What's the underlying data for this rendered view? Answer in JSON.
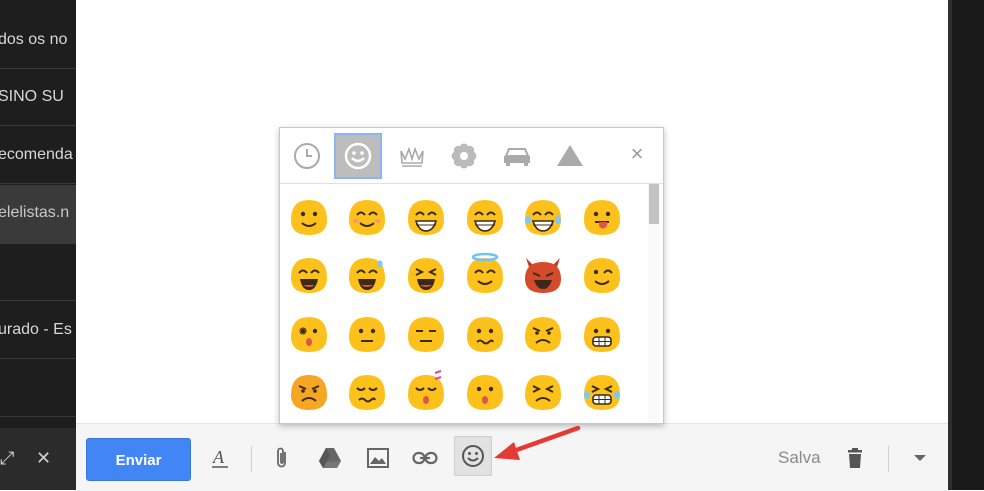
{
  "inbox": {
    "rows": [
      {
        "text": "dos os no"
      },
      {
        "text": "SINO SU"
      },
      {
        "text": "ecomenda"
      },
      {
        "text": "elelistas.n"
      },
      {
        "text": ""
      },
      {
        "text": "urado - Es"
      },
      {
        "text": ""
      }
    ]
  },
  "toolbar": {
    "send_label": "Enviar",
    "saved_label": "Salva"
  },
  "picker": {
    "close_label": "×",
    "tabs": [
      {
        "name": "recent",
        "icon": "clock-icon"
      },
      {
        "name": "people",
        "icon": "smiley-icon"
      },
      {
        "name": "objects",
        "icon": "crown-icon"
      },
      {
        "name": "nature",
        "icon": "flower-icon"
      },
      {
        "name": "places",
        "icon": "car-icon"
      },
      {
        "name": "symbols",
        "icon": "triangle-icon"
      }
    ],
    "active_tab": "people",
    "emojis": [
      "smile",
      "smiling-eyes",
      "grin",
      "grin-wide",
      "tears-of-joy",
      "tongue",
      "laughing",
      "sweat-smile",
      "wink-tongue",
      "halo",
      "devil",
      "wink",
      "surprised",
      "neutral",
      "expressionless",
      "confused",
      "angry",
      "grimace",
      "pout",
      "sad",
      "sleepy",
      "hushed",
      "persevere",
      "tired"
    ]
  },
  "colors": {
    "accent": "#4285f4",
    "emoji_yellow": "#fcc21b",
    "annotation": "#e53935"
  }
}
